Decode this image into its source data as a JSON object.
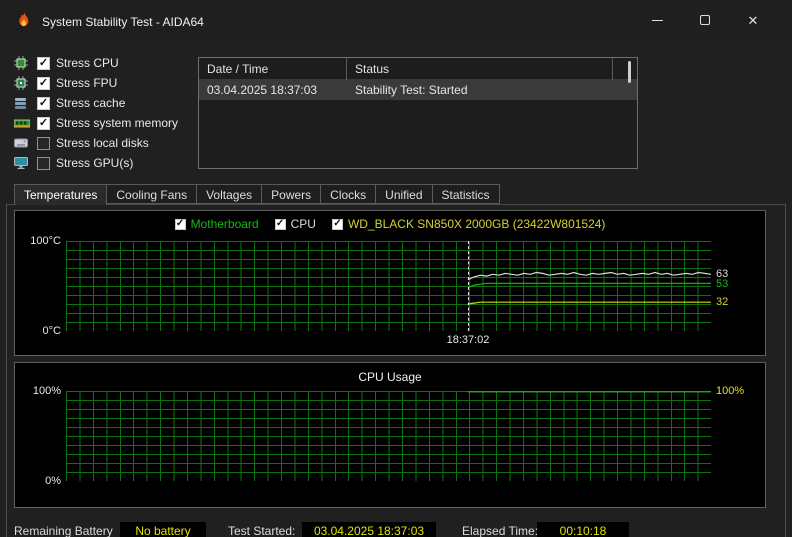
{
  "window": {
    "title": "System Stability Test - AIDA64",
    "controls": {
      "minimize": "–",
      "maximize": "▢",
      "close": "✕"
    }
  },
  "icons": {
    "app": "aida64-flame-icon",
    "stress": [
      "cpu-icon",
      "fpu-icon",
      "cache-icon",
      "memory-icon",
      "disk-icon",
      "gpu-icon"
    ]
  },
  "stress_options": [
    {
      "label": "Stress CPU",
      "checked": true
    },
    {
      "label": "Stress FPU",
      "checked": true
    },
    {
      "label": "Stress cache",
      "checked": true
    },
    {
      "label": "Stress system memory",
      "checked": true
    },
    {
      "label": "Stress local disks",
      "checked": false
    },
    {
      "label": "Stress GPU(s)",
      "checked": false
    }
  ],
  "log": {
    "columns": [
      "Date / Time",
      "Status"
    ],
    "rows": [
      {
        "datetime": "03.04.2025 18:37:03",
        "status": "Stability Test: Started"
      }
    ]
  },
  "tabs": [
    "Temperatures",
    "Cooling Fans",
    "Voltages",
    "Powers",
    "Clocks",
    "Unified",
    "Statistics"
  ],
  "active_tab": "Temperatures",
  "status_bar": {
    "battery_label": "Remaining Battery",
    "battery_value": "No battery",
    "test_started_label": "Test Started:",
    "test_started_value": "03.04.2025 18:37:03",
    "elapsed_label": "Elapsed Time:",
    "elapsed_value": "00:10:18"
  },
  "colors": {
    "grid_green": "#0d730d",
    "value_yellow": "#e4e400",
    "chart_bg": "#000000"
  },
  "chart_data": [
    {
      "type": "line",
      "panel": "Temperatures",
      "y_axis": {
        "min": 0,
        "max": 100,
        "top_label": "100°C",
        "bottom_label": "0°C"
      },
      "cursor_time": "18:37:02",
      "data_start_fraction": 0.623,
      "legend": [
        {
          "label": "Motherboard",
          "checked": true,
          "color": "#1ab41a"
        },
        {
          "label": "CPU",
          "checked": true,
          "color": "#d9d9d9"
        },
        {
          "label": "WD_BLACK SN850X 2000GB (23422W801524)",
          "checked": true,
          "color": "#d3d32e"
        }
      ],
      "series": [
        {
          "name": "CPU",
          "color": "#d9d9d9",
          "current": 63,
          "values": [
            57,
            60,
            62,
            61,
            63,
            62,
            64,
            63,
            62,
            64,
            63,
            65,
            64,
            62,
            63,
            64,
            63,
            65,
            63,
            62,
            64,
            63,
            64,
            65,
            63,
            64,
            62,
            63,
            64,
            63,
            65,
            63,
            64,
            62,
            63,
            64,
            63,
            65,
            64,
            63
          ]
        },
        {
          "name": "Motherboard",
          "color": "#1ab41a",
          "current": 53,
          "values": [
            48,
            51,
            52,
            53,
            53,
            53,
            53,
            53,
            53,
            53,
            53,
            53,
            53,
            53,
            53,
            53,
            53,
            53,
            53,
            53,
            53,
            53,
            53,
            53,
            53,
            53,
            53,
            53,
            53,
            53,
            53,
            53,
            53,
            53,
            53,
            53,
            53,
            53,
            53,
            53
          ]
        },
        {
          "name": "WD_BLACK SN850X 2000GB (23422W801524)",
          "color": "#d3d32e",
          "current": 32,
          "values": [
            30,
            31,
            32,
            32,
            32,
            32,
            32,
            32,
            32,
            32,
            32,
            32,
            32,
            32,
            32,
            32,
            32,
            32,
            32,
            32,
            32,
            32,
            32,
            32,
            32,
            32,
            32,
            32,
            32,
            32,
            32,
            32,
            32,
            32,
            32,
            32,
            32,
            32,
            32,
            32
          ]
        }
      ]
    },
    {
      "type": "line",
      "panel": "CPU Usage",
      "title": "CPU Usage",
      "y_axis": {
        "min": 0,
        "max": 100,
        "top_label": "100%",
        "bottom_label": "0%"
      },
      "right_label": {
        "text": "100%",
        "color": "#e4e400"
      },
      "data_start_fraction": 0.623,
      "series": [
        {
          "name": "CPU Usage",
          "color": "#1ac61a",
          "current": 100,
          "values": [
            100,
            100,
            100,
            100,
            100,
            100,
            100,
            100,
            100,
            100
          ]
        }
      ]
    }
  ]
}
